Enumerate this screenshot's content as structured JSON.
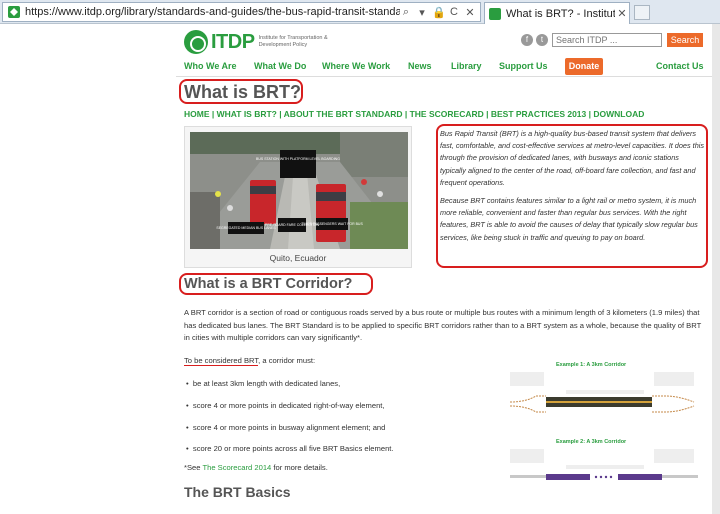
{
  "browser": {
    "url": "https://www.itdp.org/library/standards-and-guides/the-bus-rapid-transit-standard/what-is-brt/",
    "tab_title": "What is BRT? - Institute for...",
    "tab_close": "✕",
    "tools": [
      "⌕",
      "▾",
      "🔒",
      "C",
      "✕"
    ]
  },
  "header": {
    "brand": "ITDP",
    "tagline": "Institute for Transportation & Development Policy",
    "social": [
      "f",
      "t"
    ],
    "search_placeholder": "Search ITDP ...",
    "search_button": "Search"
  },
  "nav": {
    "items": [
      "Who We Are",
      "What We Do",
      "Where We Work",
      "News",
      "Library",
      "Support Us"
    ],
    "donate": "Donate",
    "contact": "Contact Us"
  },
  "page_title": "What is BRT?",
  "breadcrumb": "HOME | WHAT IS BRT? | ABOUT THE BRT STANDARD | THE SCORECARD | BEST PRACTICES 2013 | DOWNLOAD",
  "photo": {
    "caption": "Quito, Ecuador",
    "labels": [
      "BUS STATION WITH PLATFORM LEVEL BOARDING",
      "SEGREGATED MEDIAN BUS LANES",
      "PRE-BOARD FARE COLLECTION",
      "TIMES PASSENGERS WAIT FOR BUS"
    ]
  },
  "quote": {
    "p1": "Bus Rapid Transit (BRT) is a high-quality bus-based transit system that delivers fast, comfortable, and cost-effective services at metro-level capacities. It does this through the provision of dedicated lanes, with busways and iconic stations typically aligned to the center of the road, off-board fare collection, and fast and frequent operations.",
    "p2": "Because BRT contains features similar to a light rail or metro system, it is much more reliable, convenient and faster than regular bus services. With the right features, BRT is able to avoid the causes of delay that typically slow regular bus services, like being stuck in traffic and queuing to pay on board."
  },
  "corridor": {
    "heading": "What is a BRT Corridor?",
    "body": "A BRT corridor is a section of road or contiguous roads served by a bus route or multiple bus routes with a minimum length of 3 kilometers (1.9 miles) that has dedicated bus lanes. The BRT Standard is to be applied to specific BRT corridors rather than to a BRT system as a whole, because the quality of BRT in cities with multiple corridors can vary significantly*.",
    "consider_underlined": "To be considered BRT",
    "consider_rest": ", a corridor must:",
    "bullets": [
      "be at least 3km length with dedicated lanes,",
      "score 4 or more points in dedicated right-of-way element,",
      "score 4 or more points in busway alignment element; and",
      "score 20 or more points across all five BRT Basics element."
    ],
    "note_prefix": "*See ",
    "note_link": "The Scorecard 2014",
    "note_suffix": " for more details."
  },
  "examples": [
    {
      "title": "Example 1: A 3km Corridor"
    },
    {
      "title": "Example 2: A 3km Corridor"
    }
  ],
  "basics_heading": "The BRT Basics",
  "colors": {
    "brand_green": "#2a9d3f",
    "accent_orange": "#ec6a2a",
    "annotation_red": "#d81e1e"
  }
}
